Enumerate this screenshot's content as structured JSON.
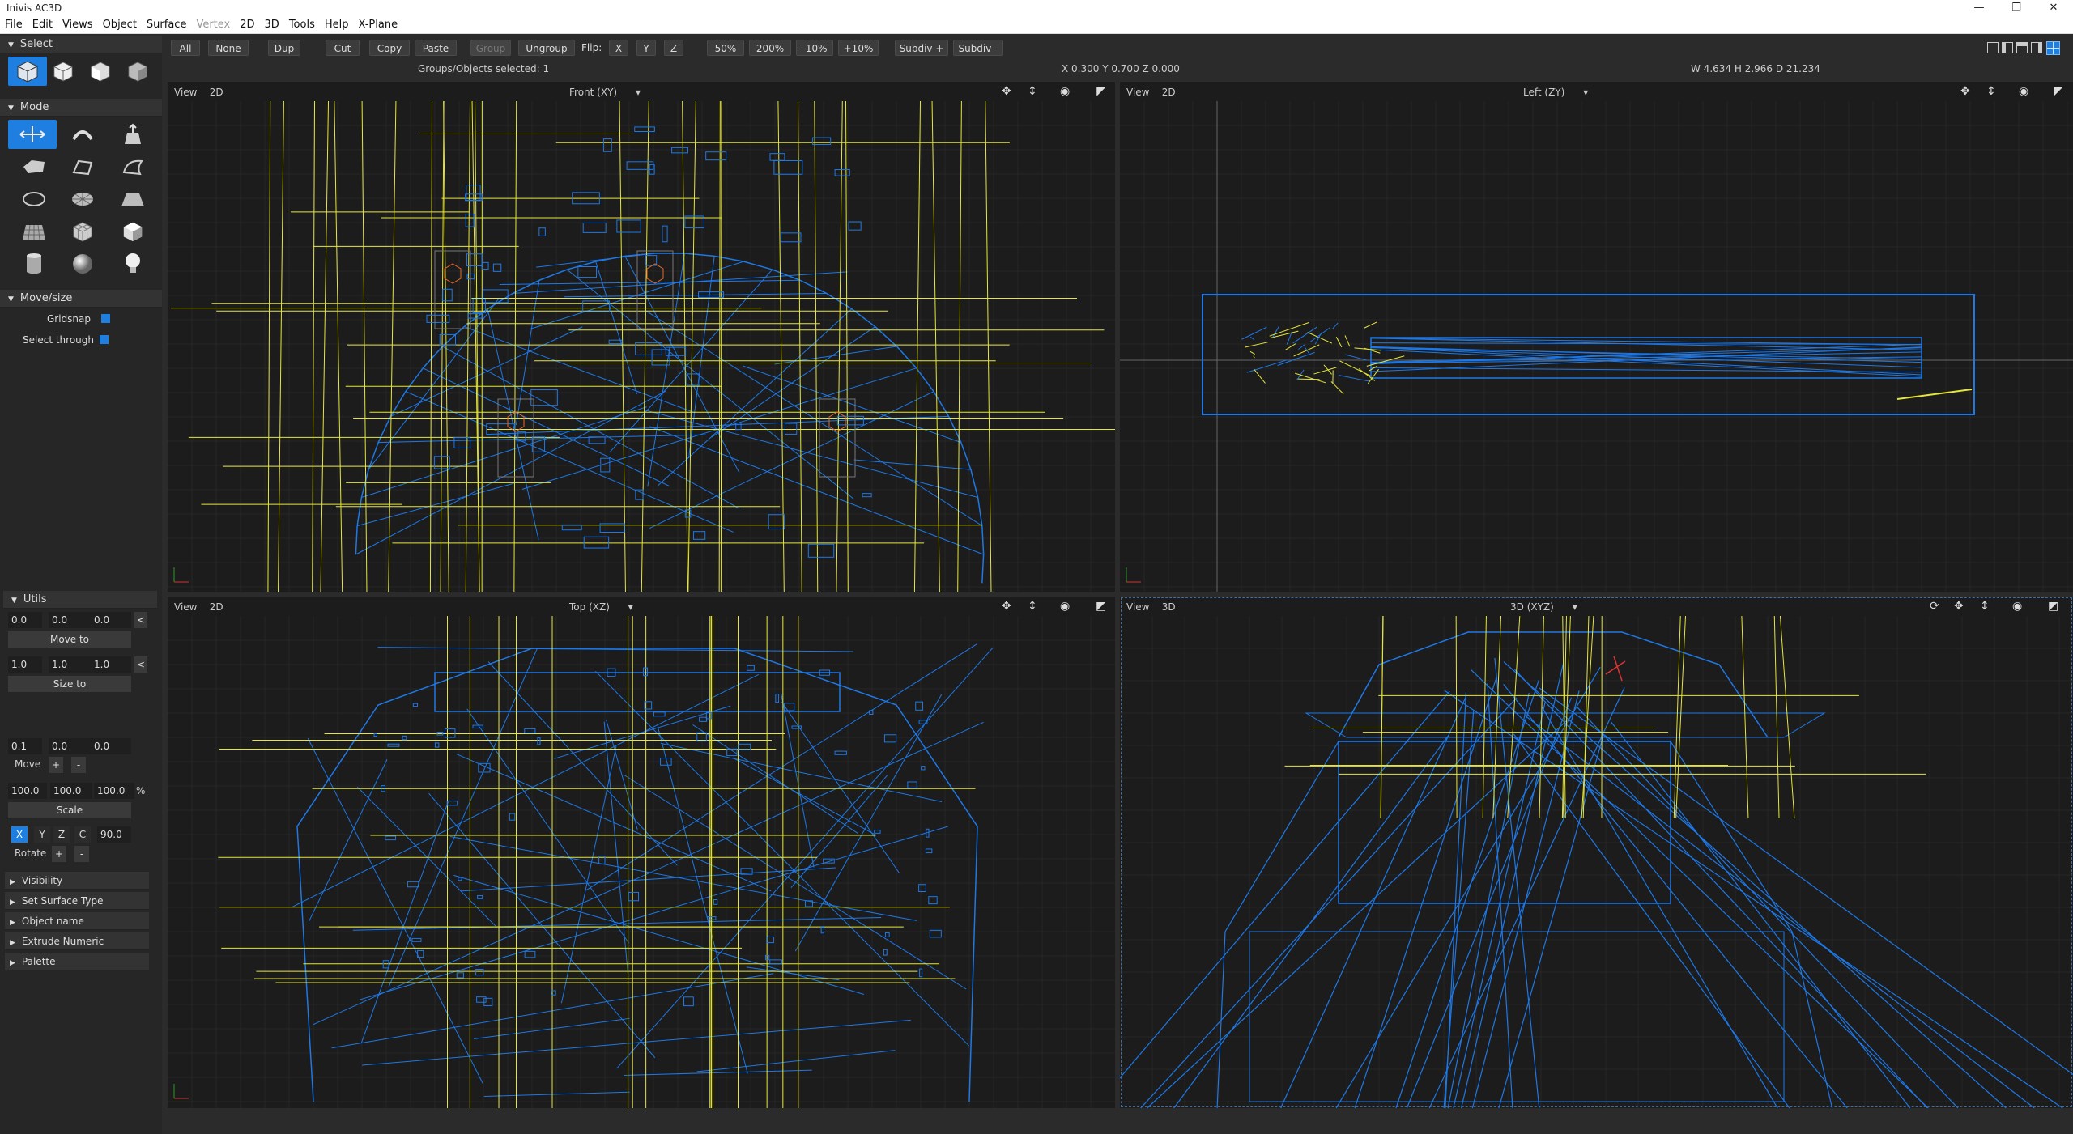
{
  "window": {
    "title": "Inivis AC3D",
    "min_icon": "—",
    "max_icon": "❐",
    "close_icon": "✕"
  },
  "menu": [
    {
      "label": "File",
      "enabled": true
    },
    {
      "label": "Edit",
      "enabled": true
    },
    {
      "label": "Views",
      "enabled": true
    },
    {
      "label": "Object",
      "enabled": true
    },
    {
      "label": "Surface",
      "enabled": true
    },
    {
      "label": "Vertex",
      "enabled": false
    },
    {
      "label": "2D",
      "enabled": true
    },
    {
      "label": "3D",
      "enabled": true
    },
    {
      "label": "Tools",
      "enabled": true
    },
    {
      "label": "Help",
      "enabled": true
    },
    {
      "label": "X-Plane",
      "enabled": true
    }
  ],
  "toolbar": {
    "all": "All",
    "none": "None",
    "dup": "Dup",
    "cut": "Cut",
    "copy": "Copy",
    "paste": "Paste",
    "group": "Group",
    "ungroup": "Ungroup",
    "flip_label": "Flip:",
    "flip_x": "X",
    "flip_y": "Y",
    "flip_z": "Z",
    "zoom50": "50%",
    "zoom200": "200%",
    "minus10": "-10%",
    "plus10": "+10%",
    "subdiv_plus": "Subdiv +",
    "subdiv_minus": "Subdiv -"
  },
  "status": {
    "selected": "Groups/Objects selected: 1",
    "position": "X 0.300 Y 0.700 Z 0.000",
    "dimensions": "W 4.634 H 2.966 D 21.234"
  },
  "panel": {
    "select_title": "Select",
    "mode_title": "Mode",
    "move_title": "Move/size",
    "gridsnap": "Gridsnap",
    "select_through": "Select through",
    "utils_title": "Utils",
    "pos": [
      "0.0",
      "0.0",
      "0.0"
    ],
    "move_to": "Move to",
    "size": [
      "1.0",
      "1.0",
      "1.0"
    ],
    "size_to": "Size to",
    "move_vals": [
      "0.1",
      "0.0",
      "0.0"
    ],
    "move": "Move",
    "scale_vals": [
      "100.0",
      "100.0",
      "100.0"
    ],
    "percent": "%",
    "scale": "Scale",
    "axes": [
      "X",
      "Y",
      "Z",
      "C"
    ],
    "angle": "90.0",
    "rotate": "Rotate",
    "plus": "+",
    "minus": "-",
    "lt": "<",
    "sections": [
      "Visibility",
      "Set Surface Type",
      "Object name",
      "Extrude Numeric",
      "Palette"
    ]
  },
  "viewports": [
    {
      "view": "View",
      "dim": "2D",
      "name": "Front (XY)"
    },
    {
      "view": "View",
      "dim": "2D",
      "name": "Left (ZY)"
    },
    {
      "view": "View",
      "dim": "2D",
      "name": "Top (XZ)"
    },
    {
      "view": "View",
      "dim": "3D",
      "name": "3D (XYZ)"
    }
  ],
  "colors": {
    "accent": "#1f7fe0",
    "wire": "#1e78e6",
    "guide": "#e6e63a",
    "bg": "#1c1c1c"
  }
}
